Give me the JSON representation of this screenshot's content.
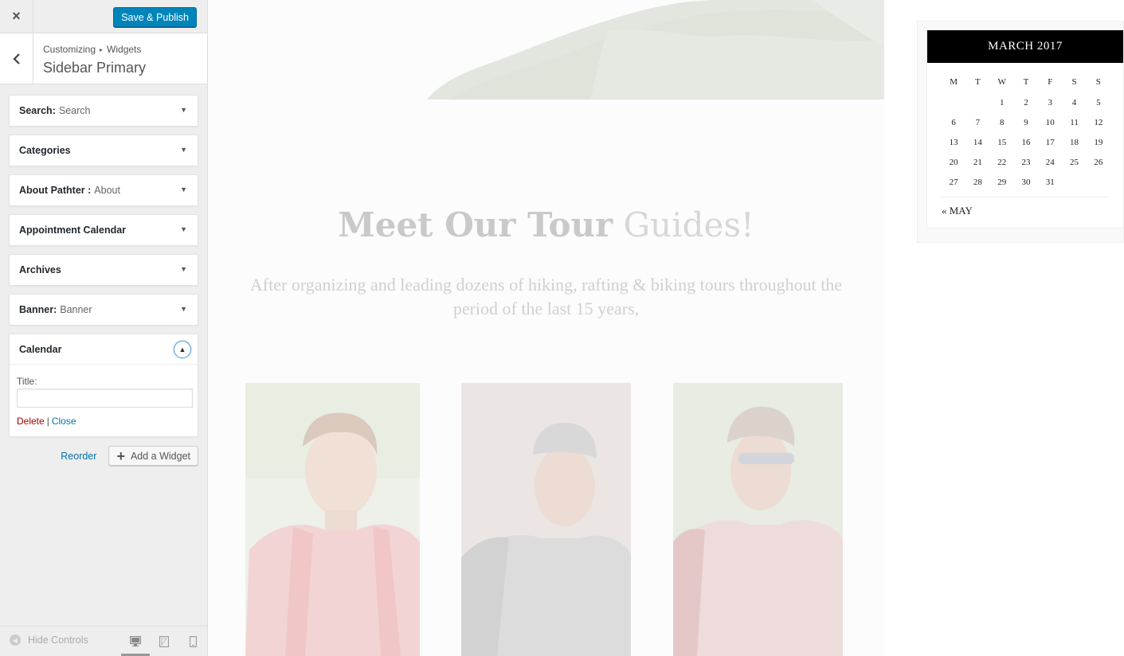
{
  "customizer": {
    "close_label": "×",
    "publish_label": "Save & Publish",
    "breadcrumb": {
      "root": "Customizing",
      "separator": "▸",
      "current": "Widgets"
    },
    "section_title": "Sidebar Primary",
    "widgets": [
      {
        "title": "Search:",
        "subtitle": "Search"
      },
      {
        "title": "Categories",
        "subtitle": ""
      },
      {
        "title": "About Pathter :",
        "subtitle": "About"
      },
      {
        "title": "Appointment Calendar",
        "subtitle": ""
      },
      {
        "title": "Archives",
        "subtitle": ""
      },
      {
        "title": "Banner:",
        "subtitle": "Banner"
      }
    ],
    "open_widget": {
      "title": "Calendar",
      "field_label": "Title:",
      "field_value": "",
      "delete_label": "Delete",
      "separator": "|",
      "close_label": "Close"
    },
    "reorder_label": "Reorder",
    "add_widget_label": "Add a Widget",
    "hide_controls_label": "Hide Controls",
    "devices": [
      "desktop-icon",
      "tablet-icon",
      "mobile-icon"
    ]
  },
  "preview": {
    "heading_bold": "Meet Our Tour",
    "heading_light": "Guides!",
    "subtitle": "After organizing and leading dozens of hiking, rafting & biking tours throughout the period of the last 15 years,",
    "calendar": {
      "month": "MARCH 2017",
      "weekdays": [
        "M",
        "T",
        "W",
        "T",
        "F",
        "S",
        "S"
      ],
      "weeks": [
        [
          "",
          "",
          "1",
          "2",
          "3",
          "4",
          "5"
        ],
        [
          "6",
          "7",
          "8",
          "9",
          "10",
          "11",
          "12"
        ],
        [
          "13",
          "14",
          "15",
          "16",
          "17",
          "18",
          "19"
        ],
        [
          "20",
          "21",
          "22",
          "23",
          "24",
          "25",
          "26"
        ],
        [
          "27",
          "28",
          "29",
          "30",
          "31",
          "",
          ""
        ]
      ],
      "prev_link": "« MAY"
    }
  },
  "colors": {
    "primary_button": "#0085ba",
    "link": "#0073aa",
    "delete": "#aa0000",
    "calendar_header": "#000000"
  }
}
